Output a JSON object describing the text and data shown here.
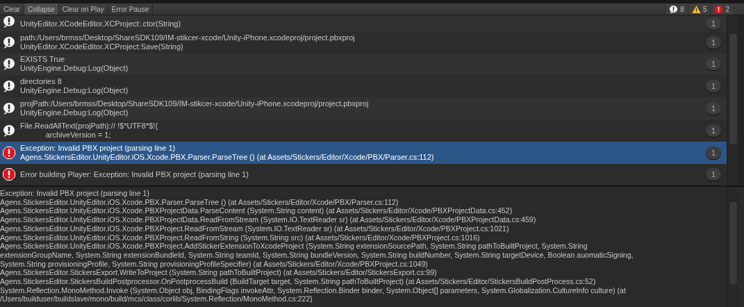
{
  "toolbar": {
    "buttons": [
      {
        "label": "Clear",
        "selected": false
      },
      {
        "label": "Collapse",
        "selected": true
      },
      {
        "label": "Clear on Play",
        "selected": false
      },
      {
        "label": "Error Pause",
        "selected": false
      }
    ],
    "counters": [
      {
        "kind": "log",
        "count": "8"
      },
      {
        "kind": "warning",
        "count": "5"
      },
      {
        "kind": "error",
        "count": "2"
      }
    ]
  },
  "entries": [
    {
      "kind": "log",
      "selected": false,
      "lines": [
        "UnityEditor.XCodeEditor.XCProject:.ctor(String)"
      ],
      "count": "1"
    },
    {
      "kind": "log",
      "selected": false,
      "lines": [
        "path:/Users/brmss/Desktop/ShareSDK109/IM-stikcer-xcode/Unity-iPhone.xcodeproj/project.pbxproj",
        "UnityEditor.XCodeEditor.XCProject:Save(String)"
      ],
      "count": "1"
    },
    {
      "kind": "log",
      "selected": false,
      "lines": [
        "EXISTS True",
        "UnityEngine.Debug:Log(Object)"
      ],
      "count": "1"
    },
    {
      "kind": "log",
      "selected": false,
      "lines": [
        "directories 8",
        "UnityEngine.Debug:Log(Object)"
      ],
      "count": "1"
    },
    {
      "kind": "log",
      "selected": false,
      "lines": [
        "projPath:/Users/brmss/Desktop/ShareSDK109/IM-stikcer-xcode/Unity-iPhone.xcodeproj/project.pbxproj",
        "UnityEngine.Debug:Log(Object)"
      ],
      "count": "1"
    },
    {
      "kind": "log",
      "selected": false,
      "lines": [
        "File.ReadAllText(projPath):// !$*UTF8*$!{",
        "            archiveVersion = 1;"
      ],
      "count": "1"
    },
    {
      "kind": "error",
      "selected": true,
      "lines": [
        "Exception: Invalid PBX project (parsing line 1)",
        "Agens.StickersEditor.UnityEditor.iOS.Xcode.PBX.Parser.ParseTree () (at Assets/Stickers/Editor/Xcode/PBX/Parser.cs:112)"
      ],
      "count": "1"
    },
    {
      "kind": "error",
      "selected": false,
      "lines": [
        "Error building Player: Exception: Invalid PBX project (parsing line 1)"
      ],
      "count": "1"
    }
  ],
  "details": [
    "Exception: Invalid PBX project (parsing line 1)",
    "Agens.StickersEditor.UnityEditor.iOS.Xcode.PBX.Parser.ParseTree () (at Assets/Stickers/Editor/Xcode/PBX/Parser.cs:112)",
    "Agens.StickersEditor.UnityEditor.iOS.Xcode.PBXProjectData.ParseContent (System.String content) (at Assets/Stickers/Editor/Xcode/PBXProjectData.cs:452)",
    "Agens.StickersEditor.UnityEditor.iOS.Xcode.PBXProjectData.ReadFromStream (System.IO.TextReader sr) (at Assets/Stickers/Editor/Xcode/PBXProjectData.cs:459)",
    "Agens.StickersEditor.UnityEditor.iOS.Xcode.PBXProject.ReadFromStream (System.IO.TextReader sr) (at Assets/Stickers/Editor/Xcode/PBXProject.cs:1021)",
    "Agens.StickersEditor.UnityEditor.iOS.Xcode.PBXProject.ReadFromString (System.String src) (at Assets/Stickers/Editor/Xcode/PBXProject.cs:1016)",
    "Agens.StickersEditor.UnityEditor.iOS.Xcode.PBXProject.AddStickerExtensionToXcodeProject (System.String extensionSourcePath, System.String pathToBuiltProject, System.String",
    "extensionGroupName, System.String extensionBundleId, System.String teamId, System.String bundleVersion, System.String buildNumber, System.String targetDevice, Boolean auomaticSigning,",
    "System.String provisioningProfile, System.String provisioningProfileSpecifier) (at Assets/Stickers/Editor/Xcode/PBXProject.cs:1049)",
    "Agens.StickersEditor.StickersExport.WriteToProject (System.String pathToBuiltProject) (at Assets/Stickers/Editor/StickersExport.cs:99)",
    "Agens.StickersEditor.StickersBuildPostprocessor.OnPostprocessBuild (BuildTarget target, System.String pathToBuiltProject) (at Assets/Stickers/Editor/StickersBuildPostProcess.cs:52)",
    "System.Reflection.MonoMethod.Invoke (System.Object obj, BindingFlags invokeAttr, System.Reflection.Binder binder, System.Object[] parameters, System.Globalization.CultureInfo culture) (at",
    "/Users/builduser/buildslave/mono/build/mcs/class/corlib/System.Reflection/MonoMethod.cs:222)"
  ]
}
